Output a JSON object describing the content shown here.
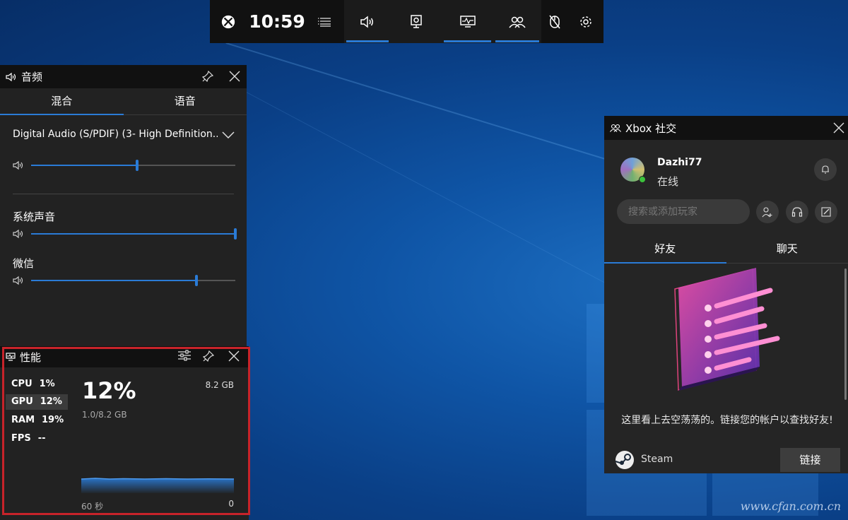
{
  "colors": {
    "accent": "#2a7bd6",
    "highlight": "#c8232a",
    "panel": "#222222",
    "header": "#111111"
  },
  "topbar": {
    "time": "10:59",
    "icons": [
      "xbox-logo-icon",
      "menu-icon",
      "audio-icon",
      "capture-icon",
      "performance-icon",
      "social-icon",
      "mouse-lock-icon",
      "settings-icon"
    ]
  },
  "audio": {
    "title": "音频",
    "tabs": [
      "混合",
      "语音"
    ],
    "device": "Digital Audio (S/PDIF) (3- High Definition...",
    "master_volume": 0.52,
    "apps": [
      {
        "name": "系统声音",
        "volume": 1.0
      },
      {
        "name": "微信",
        "volume": 0.81
      }
    ]
  },
  "performance": {
    "title": "性能",
    "metrics": [
      {
        "name": "CPU",
        "value": "1%"
      },
      {
        "name": "GPU",
        "value": "12%"
      },
      {
        "name": "RAM",
        "value": "19%"
      },
      {
        "name": "FPS",
        "value": "--"
      }
    ],
    "big_value": "12%",
    "sub_value": "1.0/8.2 GB",
    "max_label": "8.2 GB",
    "time_label": "60 秒",
    "min_label": "0"
  },
  "social": {
    "title": "Xbox 社交",
    "user": {
      "name": "Dazhi77",
      "status": "在线"
    },
    "search_placeholder": "搜索或添加玩家",
    "tabs": [
      "好友",
      "聊天"
    ],
    "empty_message": "这里看上去空荡荡的。链接您的帐户以查找好友!",
    "account": "Steam",
    "link_button": "链接"
  },
  "watermark": "www.cfan.com.cn"
}
